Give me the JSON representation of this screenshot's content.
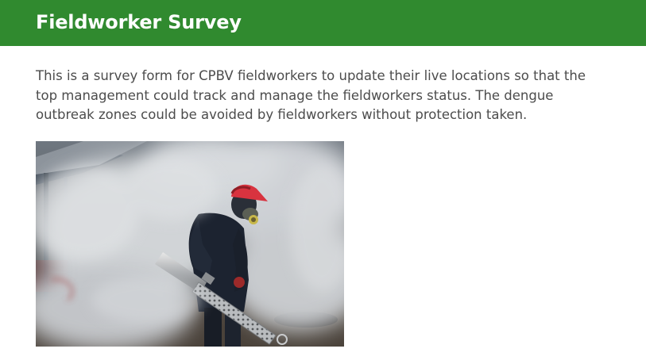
{
  "header": {
    "title": "Fieldworker Survey",
    "background_color": "#308a2f"
  },
  "intro": {
    "description": "This is a survey form for CPBV fieldworkers to update their live locations so that the top management could track and manage the fieldworkers status. The dengue outbreak zones could be avoided by fieldworkers without protection taken."
  },
  "image": {
    "subject": "fieldworker-fogging-photo"
  }
}
